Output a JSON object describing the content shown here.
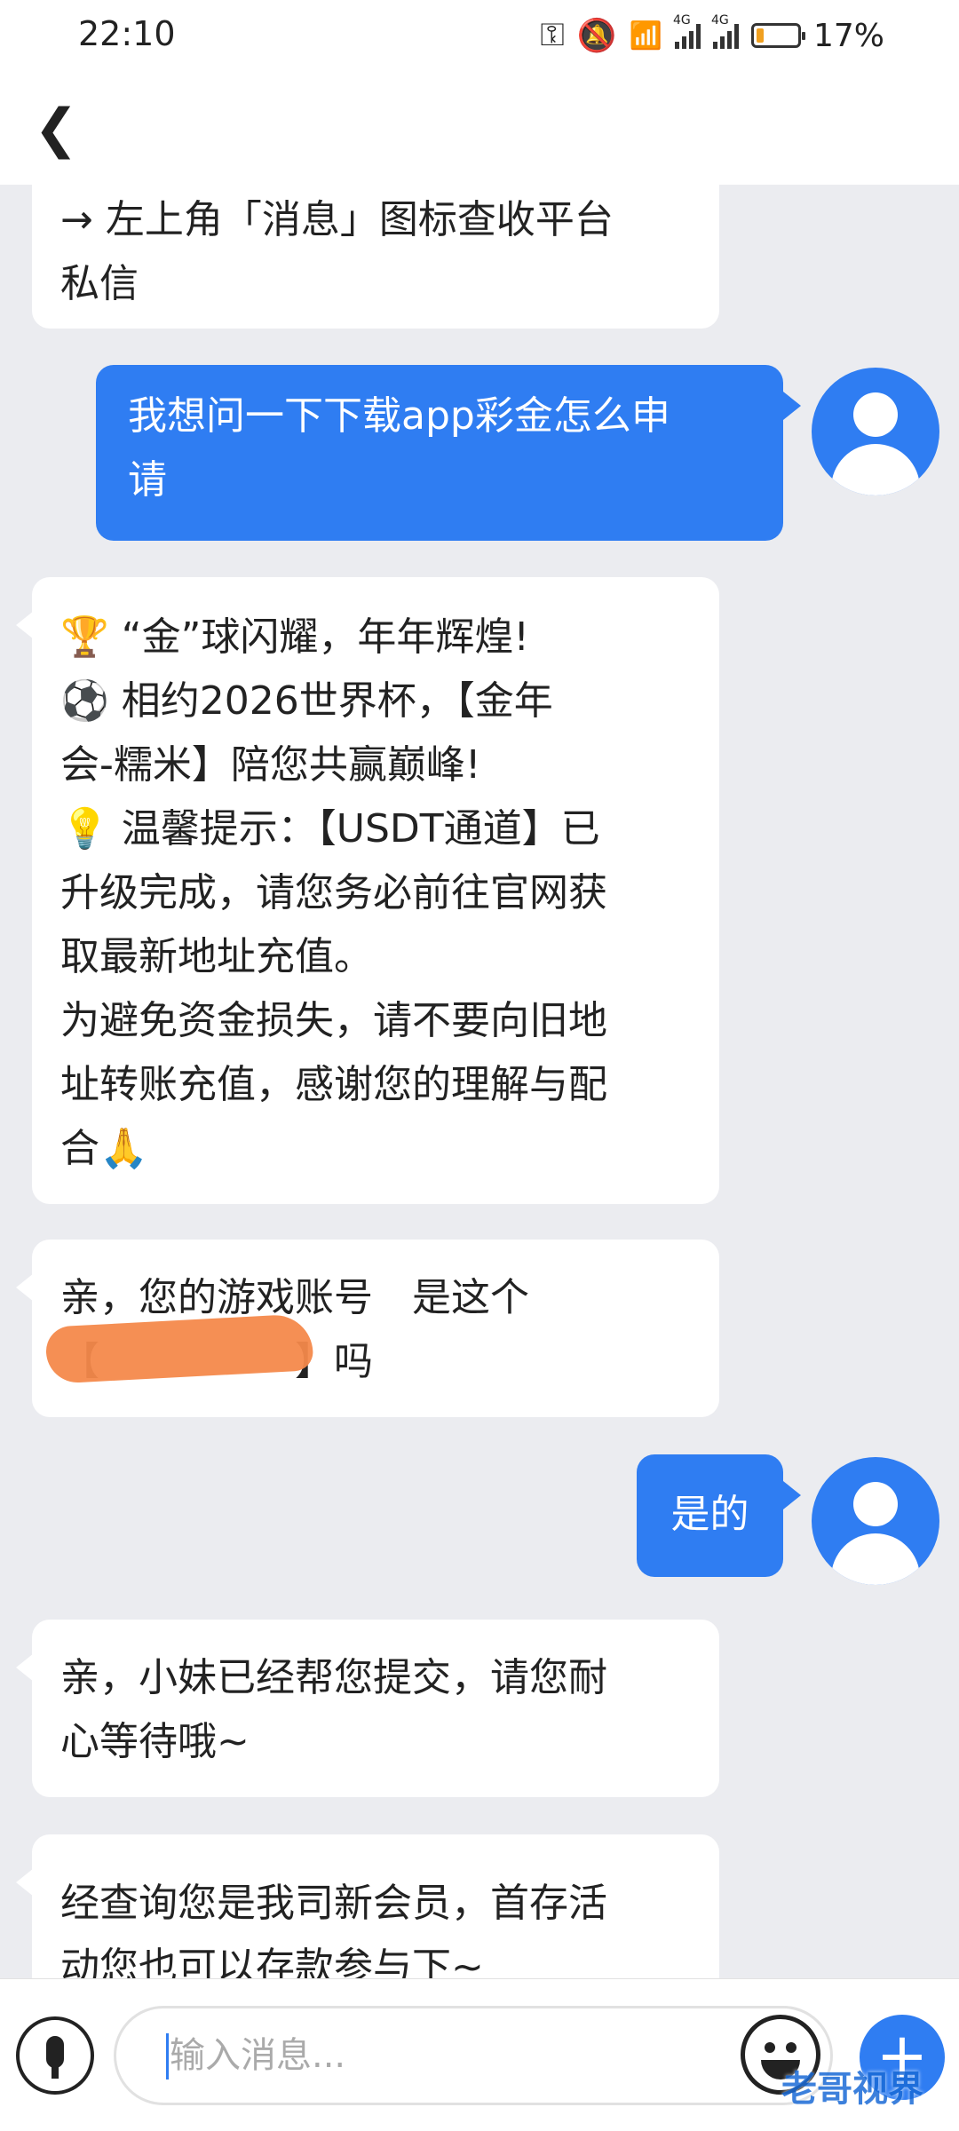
{
  "status_bar": {
    "time": "22:10",
    "battery": "17%",
    "signal_tag": "4G"
  },
  "header": {
    "back_label": "❮"
  },
  "messages": [
    {
      "side": "in",
      "lines": [
        "→ 左上角「消息」图标查收平台",
        "私信"
      ]
    },
    {
      "side": "out",
      "lines": [
        "我想问一下下载app彩金怎么申",
        "请"
      ]
    },
    {
      "side": "in",
      "lines": [
        "🏆 “金”球闪耀，年年辉煌!",
        "⚽ 相约2026世界杯，【金年",
        "会-糯米】陪您共赢巅峰!",
        "💡 温馨提示：【USDT通道】已",
        "升级完成，请您务必前往官网获",
        "取最新地址充值。",
        "为避免资金损失，请不要向旧地",
        "址转账充值，感谢您的理解与配",
        "合🙏"
      ]
    },
    {
      "side": "in",
      "lines": [
        "亲，您的游戏账号　是这个",
        "【　　　　　】吗"
      ]
    },
    {
      "side": "out",
      "lines": [
        "是的"
      ]
    },
    {
      "side": "in",
      "lines": [
        "亲，小妹已经帮您提交，请您耐",
        "心等待哦~"
      ]
    },
    {
      "side": "in",
      "lines": [
        "经查询您是我司新会员，首存活",
        "动您也可以存款参与下~"
      ]
    }
  ],
  "input_bar": {
    "placeholder": "输入消息...",
    "add_label": "+"
  },
  "watermark": "老哥视界"
}
